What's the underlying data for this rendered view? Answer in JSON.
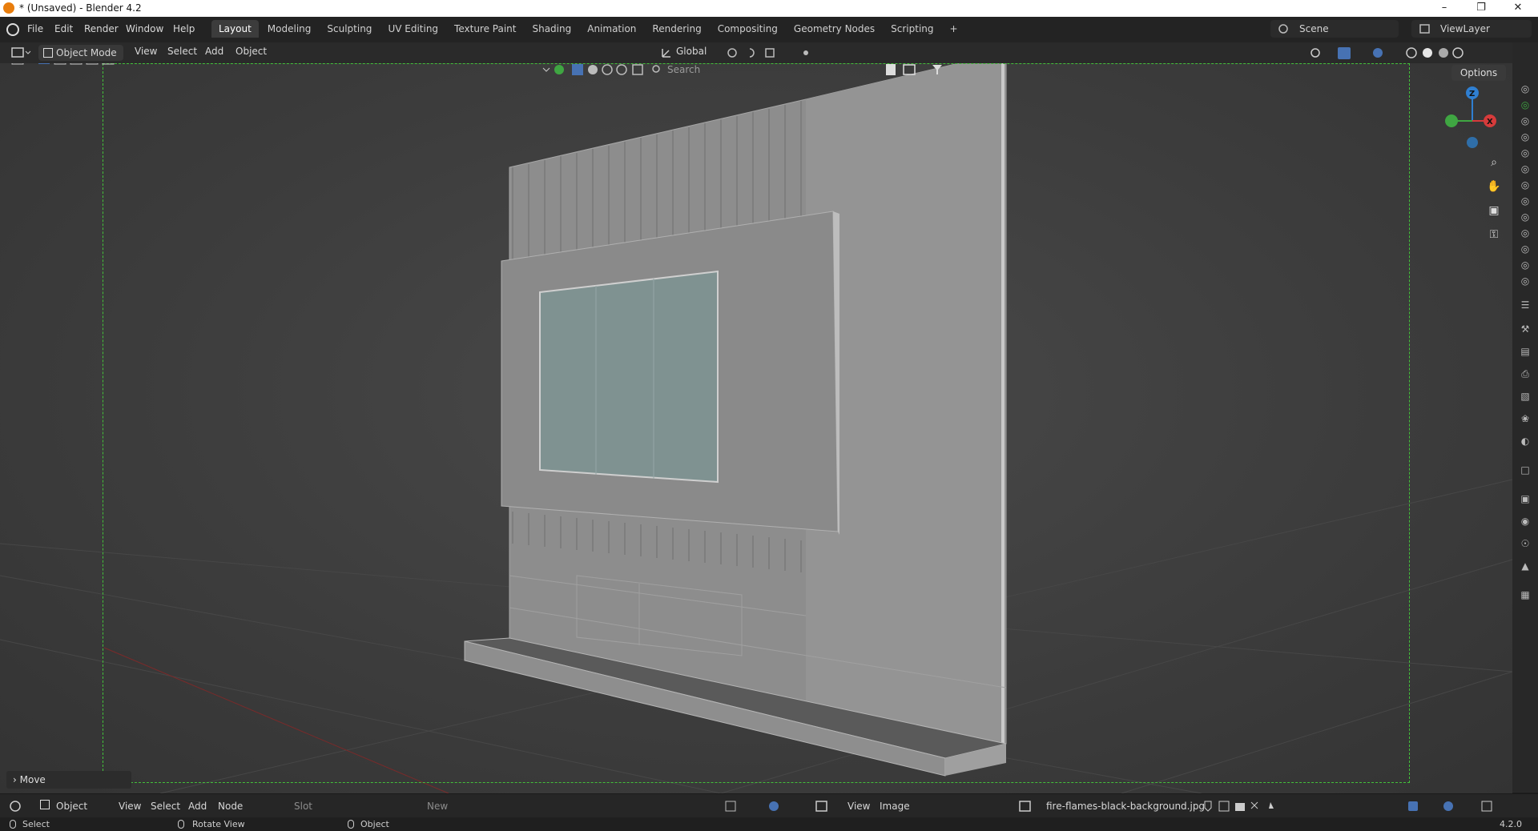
{
  "window": {
    "title": "* (Unsaved) - Blender 4.2",
    "minimize": "–",
    "maximize": "❐",
    "close": "✕"
  },
  "menu": [
    "File",
    "Edit",
    "Render",
    "Window",
    "Help"
  ],
  "workspaces": [
    "Layout",
    "Modeling",
    "Sculpting",
    "UV Editing",
    "Texture Paint",
    "Shading",
    "Animation",
    "Rendering",
    "Compositing",
    "Geometry Nodes",
    "Scripting"
  ],
  "add_workspace": "+",
  "scene": {
    "label": "Scene"
  },
  "view_layer": {
    "label": "ViewLayer"
  },
  "viewport_header": {
    "mode": "Object Mode",
    "menu": [
      "View",
      "Select",
      "Add",
      "Object"
    ],
    "transform_orientation": "Global"
  },
  "viewport_toolbar": {
    "search_placeholder": "Search"
  },
  "options_label": "Options",
  "gizmo": {
    "z": "Z",
    "x": "X"
  },
  "last_operator": "Move",
  "shader_editor": {
    "editor": "Object",
    "menu": [
      "View",
      "Select",
      "Add",
      "Node"
    ],
    "slot": "Slot",
    "new_label": "New"
  },
  "image_editor": {
    "menu": [
      "View",
      "Image"
    ],
    "image_name": "fire-flames-black-background.jpg"
  },
  "status": {
    "select": "Select",
    "rotate": "Rotate View",
    "object": "Object",
    "version": "4.2.0"
  },
  "colors": {
    "accent": "#4772b3",
    "viewport_border": "#43c13a",
    "axis_x": "#d63b3b",
    "axis_y": "#3fa642",
    "axis_z": "#2f7fd1"
  }
}
